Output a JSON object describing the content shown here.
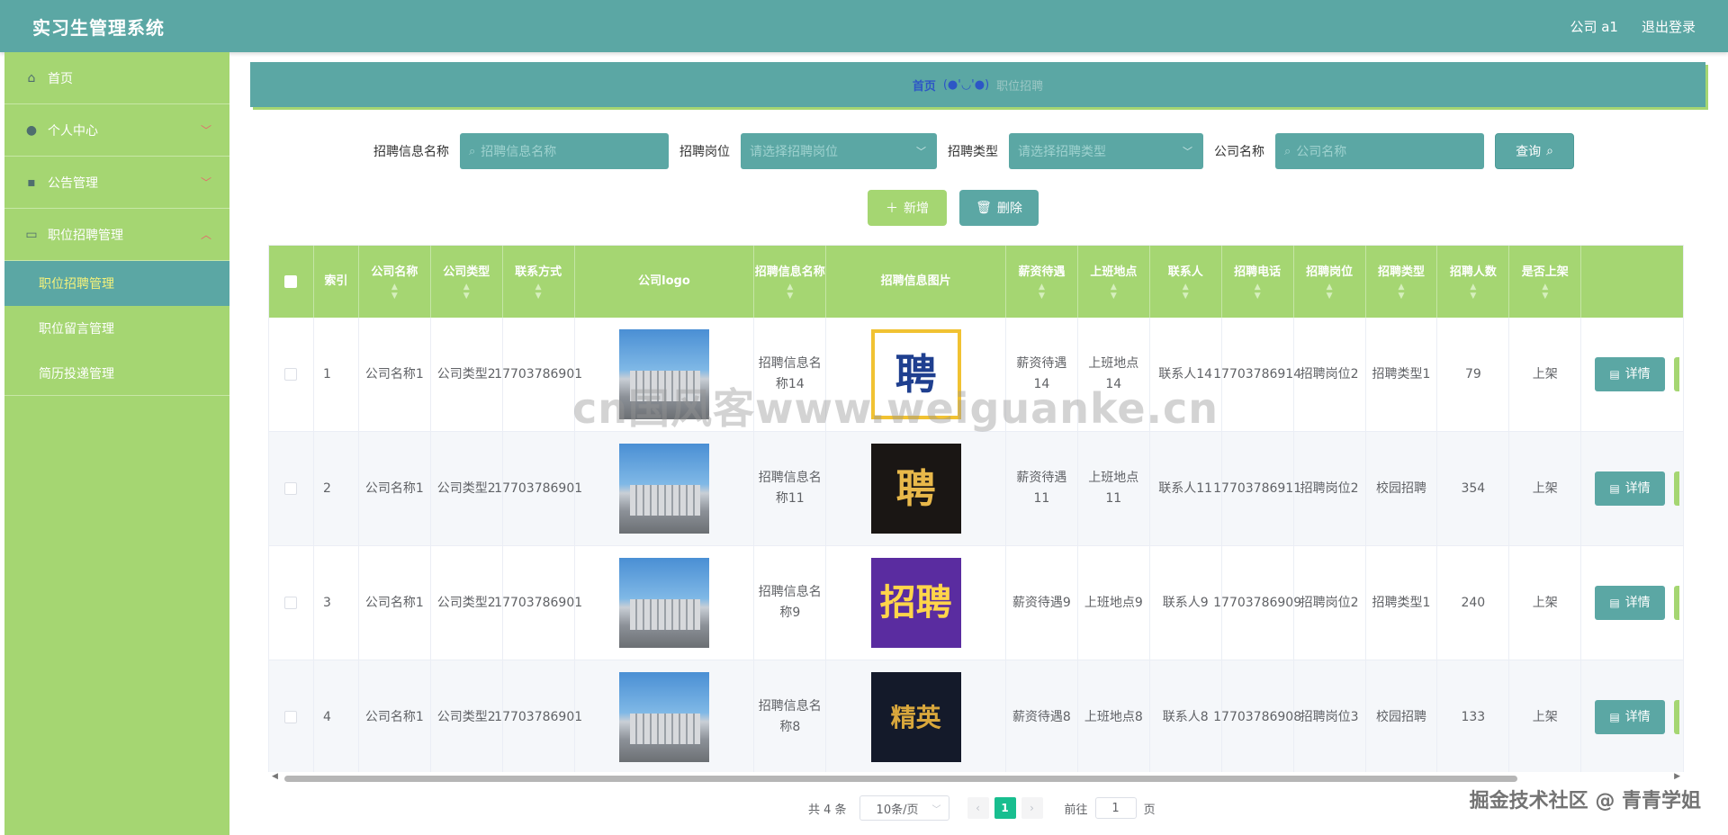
{
  "app": {
    "title": "实习生管理系统"
  },
  "topbar": {
    "user": "公司 a1",
    "logout": "退出登录"
  },
  "sidebar": {
    "home": "首页",
    "personal": "个人中心",
    "notice": "公告管理",
    "jobs": "职位招聘管理",
    "sub": [
      "职位招聘管理",
      "职位留言管理",
      "简历投递管理"
    ]
  },
  "breadcrumb": {
    "home": "首页",
    "sep": "(●'◡'●)",
    "current": "职位招聘"
  },
  "search": {
    "name_label": "招聘信息名称",
    "name_placeholder": "招聘信息名称",
    "post_label": "招聘岗位",
    "post_placeholder": "请选择招聘岗位",
    "type_label": "招聘类型",
    "type_placeholder": "请选择招聘类型",
    "company_label": "公司名称",
    "company_placeholder": "公司名称",
    "query": "查询"
  },
  "actions": {
    "add": "新增",
    "delete": "删除"
  },
  "table": {
    "headers": {
      "index": "索引",
      "company": "公司名称",
      "ctype": "公司类型",
      "contact": "联系方式",
      "logo": "公司logo",
      "info_name": "招聘信息名称",
      "info_pic": "招聘信息图片",
      "salary": "薪资待遇",
      "location": "上班地点",
      "person": "联系人",
      "phone": "招聘电话",
      "post": "招聘岗位",
      "rtype": "招聘类型",
      "count": "招聘人数",
      "online": "是否上架"
    },
    "detail_label": "详情",
    "rows": [
      {
        "index": "1",
        "company": "公司名称1",
        "ctype": "公司类型2",
        "contact": "17703786901",
        "info_name": "招聘信息名称14",
        "pic_text": "聘",
        "salary": "薪资待遇14",
        "location": "上班地点14",
        "person": "联系人14",
        "phone": "17703786914",
        "post": "招聘岗位2",
        "rtype": "招聘类型1",
        "count": "79",
        "online": "上架"
      },
      {
        "index": "2",
        "company": "公司名称1",
        "ctype": "公司类型2",
        "contact": "17703786901",
        "info_name": "招聘信息名称11",
        "pic_text": "聘",
        "salary": "薪资待遇11",
        "location": "上班地点11",
        "person": "联系人11",
        "phone": "17703786911",
        "post": "招聘岗位2",
        "rtype": "校园招聘",
        "count": "354",
        "online": "上架"
      },
      {
        "index": "3",
        "company": "公司名称1",
        "ctype": "公司类型2",
        "contact": "17703786901",
        "info_name": "招聘信息名称9",
        "pic_text": "招聘",
        "salary": "薪资待遇9",
        "location": "上班地点9",
        "person": "联系人9",
        "phone": "17703786909",
        "post": "招聘岗位2",
        "rtype": "招聘类型1",
        "count": "240",
        "online": "上架"
      },
      {
        "index": "4",
        "company": "公司名称1",
        "ctype": "公司类型2",
        "contact": "17703786901",
        "info_name": "招聘信息名称8",
        "pic_text": "精英",
        "salary": "薪资待遇8",
        "location": "上班地点8",
        "person": "联系人8",
        "phone": "17703786908",
        "post": "招聘岗位3",
        "rtype": "校园招聘",
        "count": "133",
        "online": "上架"
      }
    ]
  },
  "pager": {
    "total": "共 4 条",
    "size": "10条/页",
    "page": "1",
    "goto": "前往",
    "goto_value": "1",
    "page_unit": "页"
  },
  "watermark": "cn国风客www.weiguanke.cn",
  "credit": "掘金技术社区 @ 青青学姐",
  "colors": {
    "primary": "#5ba7a4",
    "accent": "#a5d672",
    "active_page": "#18be8f"
  }
}
